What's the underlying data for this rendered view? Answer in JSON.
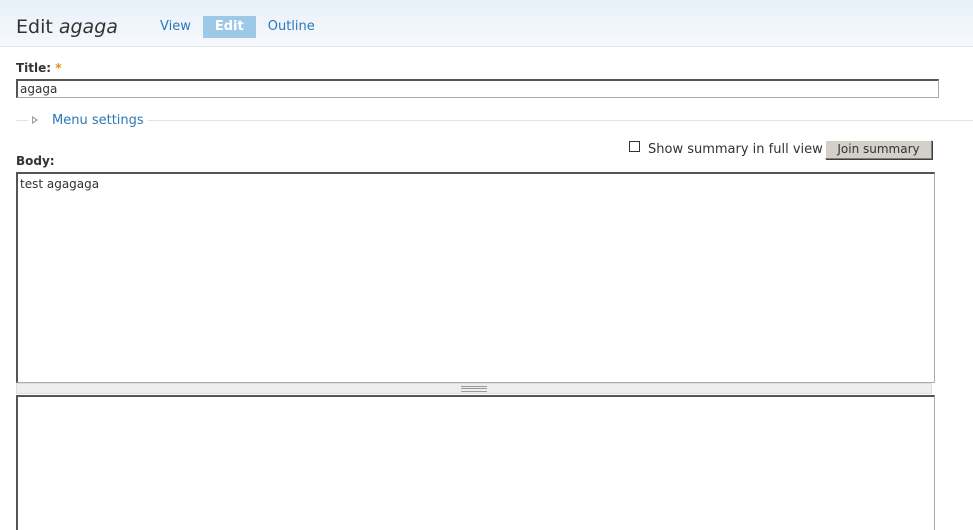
{
  "header": {
    "title_prefix": "Edit ",
    "title_node": "agaga",
    "tabs": [
      {
        "label": "View",
        "active": false
      },
      {
        "label": "Edit",
        "active": true
      },
      {
        "label": "Outline",
        "active": false
      }
    ]
  },
  "form": {
    "title_label": "Title:",
    "required_marker": "*",
    "title_value": "agaga",
    "menu_settings_label": "Menu settings",
    "body_label": "Body:",
    "show_summary_label": "Show summary in full view",
    "show_summary_checked": false,
    "join_summary_label": "Join summary",
    "body_value": "test agagaga",
    "second_value": ""
  },
  "colors": {
    "link": "#2a78b8",
    "active_tab_bg": "#9ec8e8",
    "required": "#e09010",
    "header_bg": "#e8f0f8"
  }
}
